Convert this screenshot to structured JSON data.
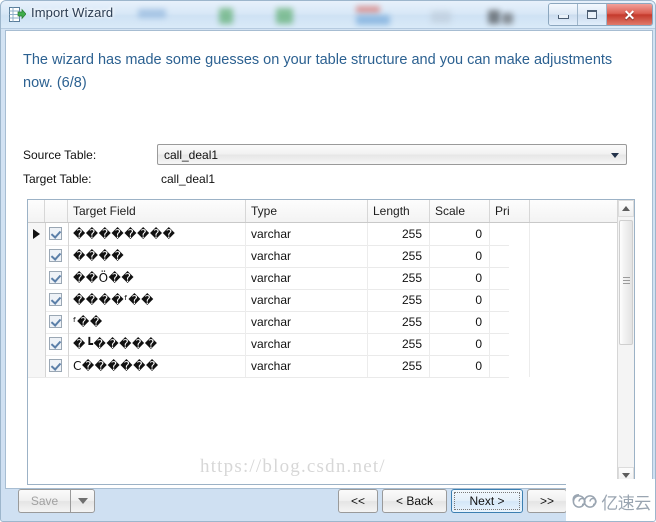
{
  "window": {
    "title": "Import Wizard",
    "icon": "import-wizard-icon",
    "controls": {
      "minimize": "minimize-icon",
      "maximize": "maximize-icon",
      "close": "✕"
    }
  },
  "dialog": {
    "headline": "The wizard has made some guesses on your table structure and you can make adjustments now. (6/8)",
    "source_table_label": "Source Table:",
    "source_table_value": "call_deal1",
    "target_table_label": "Target Table:",
    "target_table_value": "call_deal1"
  },
  "grid": {
    "columns": [
      "Target Field",
      "Type",
      "Length",
      "Scale",
      "Pri"
    ],
    "rows": [
      {
        "selected": true,
        "checked": true,
        "target_field": "��������",
        "type": "varchar",
        "length": "255",
        "scale": "0"
      },
      {
        "selected": false,
        "checked": true,
        "target_field": "����",
        "type": "varchar",
        "length": "255",
        "scale": "0"
      },
      {
        "selected": false,
        "checked": true,
        "target_field": "��Ö��",
        "type": "varchar",
        "length": "255",
        "scale": "0"
      },
      {
        "selected": false,
        "checked": true,
        "target_field": "����ᶠ��",
        "type": "varchar",
        "length": "255",
        "scale": "0"
      },
      {
        "selected": false,
        "checked": true,
        "target_field": "ᶠ��",
        "type": "varchar",
        "length": "255",
        "scale": "0"
      },
      {
        "selected": false,
        "checked": true,
        "target_field": "�┗�����",
        "type": "varchar",
        "length": "255",
        "scale": "0"
      },
      {
        "selected": false,
        "checked": true,
        "target_field": "C������",
        "type": "varchar",
        "length": "255",
        "scale": "0"
      }
    ]
  },
  "watermark": "https://blog.csdn.net/",
  "footer": {
    "save": "Save",
    "first": "<<",
    "back": "< Back",
    "next": "Next >",
    "last": ">>"
  },
  "logo": {
    "text": "亿速云"
  },
  "colors": {
    "headline": "#2c6191",
    "titlebar": "#d8e8f7",
    "close_button": "#c53a2c",
    "focus_border": "#3c7fb1"
  }
}
